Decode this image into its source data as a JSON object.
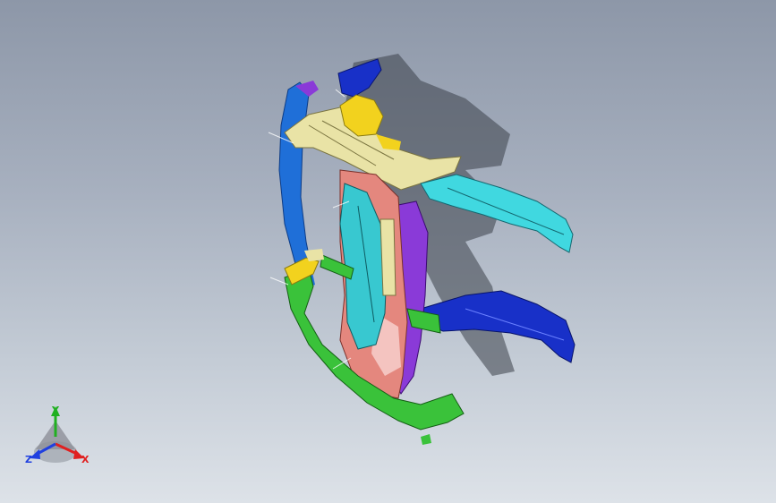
{
  "viewport": {
    "background_top": "#8d97a8",
    "background_bottom": "#dde2e8"
  },
  "model": {
    "part_colors": {
      "frame_outer": "#1f6fd8",
      "upper_rail": "#e9e3a6",
      "top_mount": "#f2d21e",
      "front_rail": "#40d8e0",
      "lower_rail": "#1830c8",
      "center_pillar": "#38c8d0",
      "inner_panel": "#e4877e",
      "rear_panel": "#8a3ad8",
      "lower_frame": "#3ac23a",
      "shadow": "#3a3f48"
    }
  },
  "triad": {
    "x_label": "X",
    "y_label": "Y",
    "z_label": "Z",
    "x_color": "#e02020",
    "y_color": "#20b020",
    "z_color": "#2040e0"
  }
}
